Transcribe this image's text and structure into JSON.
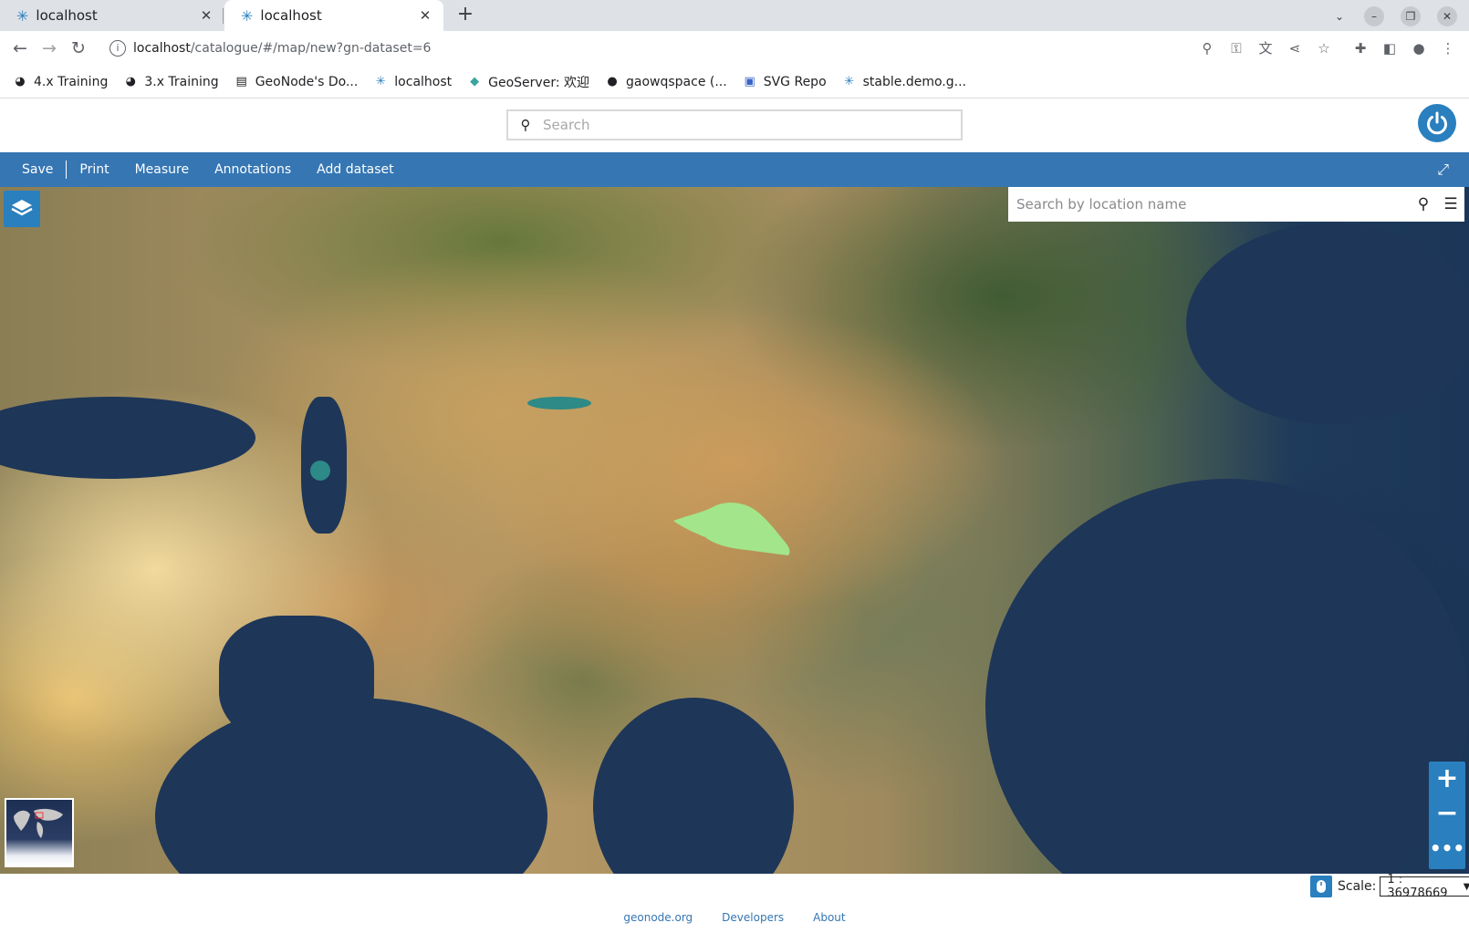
{
  "browser": {
    "tabs": [
      {
        "title": "localhost",
        "active": false
      },
      {
        "title": "localhost",
        "active": true
      }
    ],
    "address": {
      "host": "localhost",
      "path": "/catalogue/#/map/new?gn-dataset=6"
    },
    "bookmarks": [
      {
        "label": "4.x Training",
        "icon": "globe-icon"
      },
      {
        "label": "3.x Training",
        "icon": "globe-icon"
      },
      {
        "label": "GeoNode's Do...",
        "icon": "book-icon"
      },
      {
        "label": "localhost",
        "icon": "geonode-icon"
      },
      {
        "label": "GeoServer: 欢迎",
        "icon": "geoserver-icon"
      },
      {
        "label": "gaowqspace (...",
        "icon": "github-icon"
      },
      {
        "label": "SVG Repo",
        "icon": "svgrepo-icon"
      },
      {
        "label": "stable.demo.g...",
        "icon": "geonode-icon"
      }
    ]
  },
  "header": {
    "search_placeholder": "Search"
  },
  "toolbar": {
    "save": "Save",
    "print": "Print",
    "measure": "Measure",
    "annotations": "Annotations",
    "add_dataset": "Add dataset"
  },
  "map": {
    "location_search_placeholder": "Search by location name",
    "highlight_color": "#a3e58a"
  },
  "scale": {
    "label": "Scale:",
    "value": "1 : 36978669"
  },
  "footer": {
    "links": [
      "geonode.org",
      "Developers",
      "About"
    ]
  },
  "colors": {
    "primary": "#2a7fbe",
    "toolbar": "#3576b3"
  }
}
